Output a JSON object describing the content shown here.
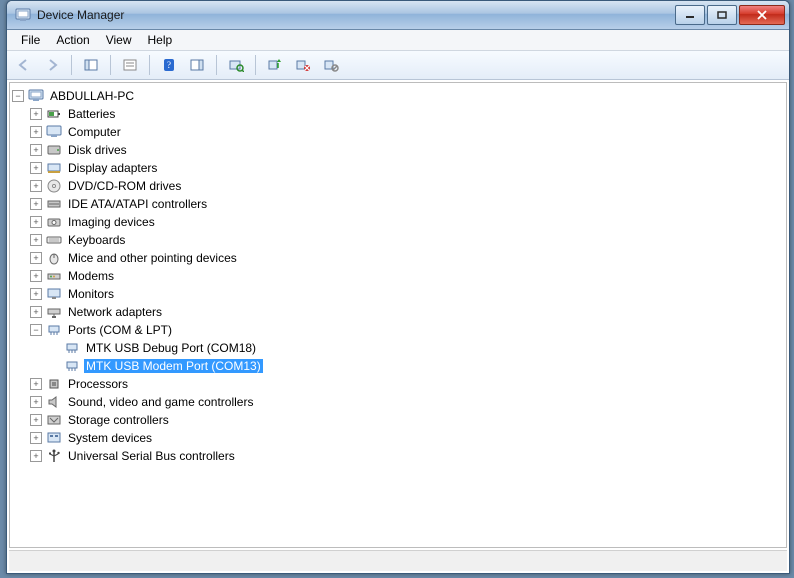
{
  "window": {
    "title": "Device Manager"
  },
  "menu": {
    "file": "File",
    "action": "Action",
    "view": "View",
    "help": "Help"
  },
  "tree": {
    "root": "ABDULLAH-PC",
    "batteries": "Batteries",
    "computer": "Computer",
    "disk_drives": "Disk drives",
    "display_adapters": "Display adapters",
    "dvd_cd": "DVD/CD-ROM drives",
    "ide_ata": "IDE ATA/ATAPI controllers",
    "imaging": "Imaging devices",
    "keyboards": "Keyboards",
    "mice": "Mice and other pointing devices",
    "modems": "Modems",
    "monitors": "Monitors",
    "network": "Network adapters",
    "ports": "Ports (COM & LPT)",
    "port_debug": "MTK USB Debug Port (COM18)",
    "port_modem": "MTK USB Modem Port (COM13)",
    "processors": "Processors",
    "sound": "Sound, video and game controllers",
    "storage": "Storage controllers",
    "system": "System devices",
    "usb": "Universal Serial Bus controllers"
  }
}
